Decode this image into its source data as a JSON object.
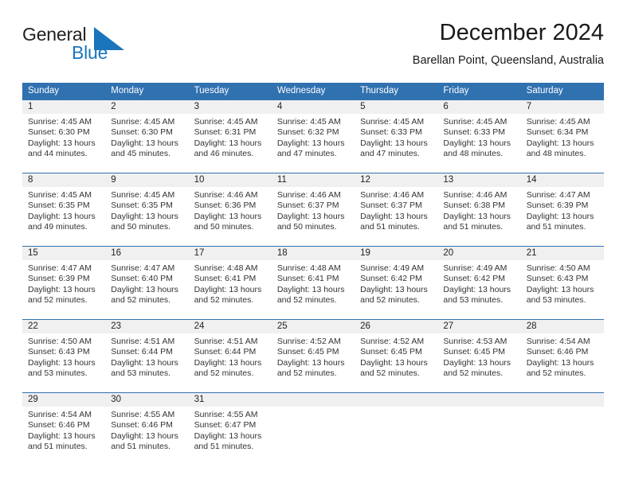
{
  "brand": {
    "name_part1": "General",
    "name_part2": "Blue",
    "logo_icon": "triangle-flag-icon",
    "accent_color": "#1b75bc"
  },
  "header": {
    "title": "December 2024",
    "subtitle": "Barellan Point, Queensland, Australia"
  },
  "theme": {
    "header_blue": "#3071b0",
    "daynum_bg": "#f0f0f0",
    "text": "#333333"
  },
  "calendar": {
    "weekdays": [
      "Sunday",
      "Monday",
      "Tuesday",
      "Wednesday",
      "Thursday",
      "Friday",
      "Saturday"
    ],
    "weeks": [
      [
        {
          "day": "1",
          "sunrise": "Sunrise: 4:45 AM",
          "sunset": "Sunset: 6:30 PM",
          "daylight_line1": "Daylight: 13 hours",
          "daylight_line2": "and 44 minutes."
        },
        {
          "day": "2",
          "sunrise": "Sunrise: 4:45 AM",
          "sunset": "Sunset: 6:30 PM",
          "daylight_line1": "Daylight: 13 hours",
          "daylight_line2": "and 45 minutes."
        },
        {
          "day": "3",
          "sunrise": "Sunrise: 4:45 AM",
          "sunset": "Sunset: 6:31 PM",
          "daylight_line1": "Daylight: 13 hours",
          "daylight_line2": "and 46 minutes."
        },
        {
          "day": "4",
          "sunrise": "Sunrise: 4:45 AM",
          "sunset": "Sunset: 6:32 PM",
          "daylight_line1": "Daylight: 13 hours",
          "daylight_line2": "and 47 minutes."
        },
        {
          "day": "5",
          "sunrise": "Sunrise: 4:45 AM",
          "sunset": "Sunset: 6:33 PM",
          "daylight_line1": "Daylight: 13 hours",
          "daylight_line2": "and 47 minutes."
        },
        {
          "day": "6",
          "sunrise": "Sunrise: 4:45 AM",
          "sunset": "Sunset: 6:33 PM",
          "daylight_line1": "Daylight: 13 hours",
          "daylight_line2": "and 48 minutes."
        },
        {
          "day": "7",
          "sunrise": "Sunrise: 4:45 AM",
          "sunset": "Sunset: 6:34 PM",
          "daylight_line1": "Daylight: 13 hours",
          "daylight_line2": "and 48 minutes."
        }
      ],
      [
        {
          "day": "8",
          "sunrise": "Sunrise: 4:45 AM",
          "sunset": "Sunset: 6:35 PM",
          "daylight_line1": "Daylight: 13 hours",
          "daylight_line2": "and 49 minutes."
        },
        {
          "day": "9",
          "sunrise": "Sunrise: 4:45 AM",
          "sunset": "Sunset: 6:35 PM",
          "daylight_line1": "Daylight: 13 hours",
          "daylight_line2": "and 50 minutes."
        },
        {
          "day": "10",
          "sunrise": "Sunrise: 4:46 AM",
          "sunset": "Sunset: 6:36 PM",
          "daylight_line1": "Daylight: 13 hours",
          "daylight_line2": "and 50 minutes."
        },
        {
          "day": "11",
          "sunrise": "Sunrise: 4:46 AM",
          "sunset": "Sunset: 6:37 PM",
          "daylight_line1": "Daylight: 13 hours",
          "daylight_line2": "and 50 minutes."
        },
        {
          "day": "12",
          "sunrise": "Sunrise: 4:46 AM",
          "sunset": "Sunset: 6:37 PM",
          "daylight_line1": "Daylight: 13 hours",
          "daylight_line2": "and 51 minutes."
        },
        {
          "day": "13",
          "sunrise": "Sunrise: 4:46 AM",
          "sunset": "Sunset: 6:38 PM",
          "daylight_line1": "Daylight: 13 hours",
          "daylight_line2": "and 51 minutes."
        },
        {
          "day": "14",
          "sunrise": "Sunrise: 4:47 AM",
          "sunset": "Sunset: 6:39 PM",
          "daylight_line1": "Daylight: 13 hours",
          "daylight_line2": "and 51 minutes."
        }
      ],
      [
        {
          "day": "15",
          "sunrise": "Sunrise: 4:47 AM",
          "sunset": "Sunset: 6:39 PM",
          "daylight_line1": "Daylight: 13 hours",
          "daylight_line2": "and 52 minutes."
        },
        {
          "day": "16",
          "sunrise": "Sunrise: 4:47 AM",
          "sunset": "Sunset: 6:40 PM",
          "daylight_line1": "Daylight: 13 hours",
          "daylight_line2": "and 52 minutes."
        },
        {
          "day": "17",
          "sunrise": "Sunrise: 4:48 AM",
          "sunset": "Sunset: 6:41 PM",
          "daylight_line1": "Daylight: 13 hours",
          "daylight_line2": "and 52 minutes."
        },
        {
          "day": "18",
          "sunrise": "Sunrise: 4:48 AM",
          "sunset": "Sunset: 6:41 PM",
          "daylight_line1": "Daylight: 13 hours",
          "daylight_line2": "and 52 minutes."
        },
        {
          "day": "19",
          "sunrise": "Sunrise: 4:49 AM",
          "sunset": "Sunset: 6:42 PM",
          "daylight_line1": "Daylight: 13 hours",
          "daylight_line2": "and 52 minutes."
        },
        {
          "day": "20",
          "sunrise": "Sunrise: 4:49 AM",
          "sunset": "Sunset: 6:42 PM",
          "daylight_line1": "Daylight: 13 hours",
          "daylight_line2": "and 53 minutes."
        },
        {
          "day": "21",
          "sunrise": "Sunrise: 4:50 AM",
          "sunset": "Sunset: 6:43 PM",
          "daylight_line1": "Daylight: 13 hours",
          "daylight_line2": "and 53 minutes."
        }
      ],
      [
        {
          "day": "22",
          "sunrise": "Sunrise: 4:50 AM",
          "sunset": "Sunset: 6:43 PM",
          "daylight_line1": "Daylight: 13 hours",
          "daylight_line2": "and 53 minutes."
        },
        {
          "day": "23",
          "sunrise": "Sunrise: 4:51 AM",
          "sunset": "Sunset: 6:44 PM",
          "daylight_line1": "Daylight: 13 hours",
          "daylight_line2": "and 53 minutes."
        },
        {
          "day": "24",
          "sunrise": "Sunrise: 4:51 AM",
          "sunset": "Sunset: 6:44 PM",
          "daylight_line1": "Daylight: 13 hours",
          "daylight_line2": "and 52 minutes."
        },
        {
          "day": "25",
          "sunrise": "Sunrise: 4:52 AM",
          "sunset": "Sunset: 6:45 PM",
          "daylight_line1": "Daylight: 13 hours",
          "daylight_line2": "and 52 minutes."
        },
        {
          "day": "26",
          "sunrise": "Sunrise: 4:52 AM",
          "sunset": "Sunset: 6:45 PM",
          "daylight_line1": "Daylight: 13 hours",
          "daylight_line2": "and 52 minutes."
        },
        {
          "day": "27",
          "sunrise": "Sunrise: 4:53 AM",
          "sunset": "Sunset: 6:45 PM",
          "daylight_line1": "Daylight: 13 hours",
          "daylight_line2": "and 52 minutes."
        },
        {
          "day": "28",
          "sunrise": "Sunrise: 4:54 AM",
          "sunset": "Sunset: 6:46 PM",
          "daylight_line1": "Daylight: 13 hours",
          "daylight_line2": "and 52 minutes."
        }
      ],
      [
        {
          "day": "29",
          "sunrise": "Sunrise: 4:54 AM",
          "sunset": "Sunset: 6:46 PM",
          "daylight_line1": "Daylight: 13 hours",
          "daylight_line2": "and 51 minutes."
        },
        {
          "day": "30",
          "sunrise": "Sunrise: 4:55 AM",
          "sunset": "Sunset: 6:46 PM",
          "daylight_line1": "Daylight: 13 hours",
          "daylight_line2": "and 51 minutes."
        },
        {
          "day": "31",
          "sunrise": "Sunrise: 4:55 AM",
          "sunset": "Sunset: 6:47 PM",
          "daylight_line1": "Daylight: 13 hours",
          "daylight_line2": "and 51 minutes."
        },
        {
          "day": "",
          "sunrise": "",
          "sunset": "",
          "daylight_line1": "",
          "daylight_line2": ""
        },
        {
          "day": "",
          "sunrise": "",
          "sunset": "",
          "daylight_line1": "",
          "daylight_line2": ""
        },
        {
          "day": "",
          "sunrise": "",
          "sunset": "",
          "daylight_line1": "",
          "daylight_line2": ""
        },
        {
          "day": "",
          "sunrise": "",
          "sunset": "",
          "daylight_line1": "",
          "daylight_line2": ""
        }
      ]
    ]
  }
}
